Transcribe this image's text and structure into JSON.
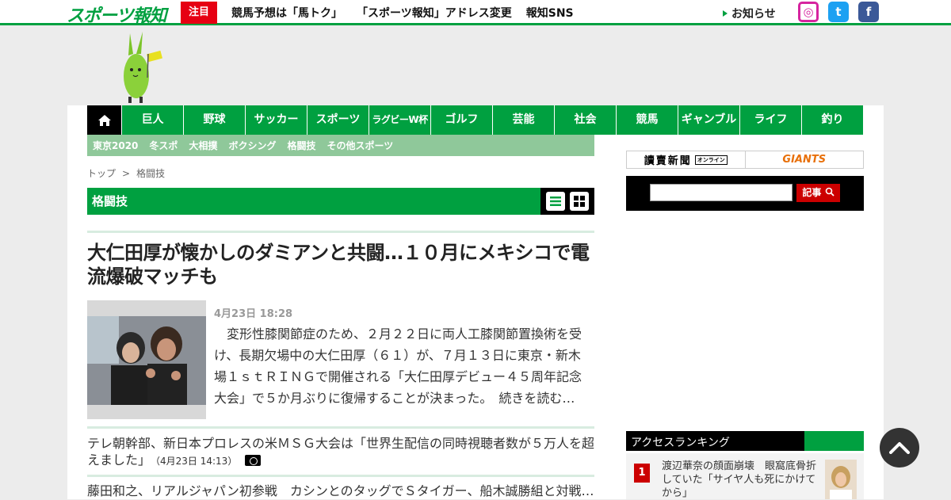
{
  "header": {
    "logo_text": "スポーツ報知",
    "badge": "注目",
    "links": [
      "競馬予想は「馬トク」",
      "「スポーツ報知」アドレス変更",
      "報知SNS"
    ],
    "notice": "お知らせ",
    "sns": [
      {
        "name": "instagram",
        "glyph": "◎"
      },
      {
        "name": "twitter",
        "glyph": "t"
      },
      {
        "name": "facebook",
        "glyph": "f"
      }
    ]
  },
  "nav": {
    "items": [
      "巨人",
      "野球",
      "サッカー",
      "スポーツ",
      "ラグビーW杯",
      "ゴルフ",
      "芸能",
      "社会",
      "競馬",
      "ギャンブル",
      "ライフ",
      "釣り"
    ],
    "sub_items": [
      "東京2020",
      "冬スポ",
      "大相撲",
      "ボクシング",
      "格闘技",
      "その他スポーツ"
    ]
  },
  "breadcrumb": {
    "home": "トップ",
    "separator": ">",
    "current": "格闘技"
  },
  "category": {
    "title": "格闘技"
  },
  "lead_article": {
    "title": "大仁田厚が懐かしのダミアンと共闘…１０月にメキシコで電流爆破マッチも",
    "date": "4月23日 18:28",
    "summary": "　変形性膝関節症のため、２月２２日に両人工膝関節置換術を受け、長期欠場中の大仁田厚（６１）が、７月１３日に東京・新木場１ｓｔＲＩＮＧで開催される「大仁田厚デビュー４５周年記念大会」で５か月ぶりに復帰することが決まった。",
    "read_more": "続きを読む…"
  },
  "articles": [
    {
      "title": "テレ朝幹部、新日本プロレスの米ＭＳＧ大会は「世界生配信の同時視聴者数が５万人を超えました」",
      "time": "（4月23日 14:13）",
      "has_photo": true
    },
    {
      "title": "藤田和之、リアルジャパン初参戦　カシンとのタッグでＳタイガー、船木誠勝組と対戦…",
      "time": "",
      "has_photo": false
    }
  ],
  "sidebar": {
    "banner_left": "讀賣新聞",
    "banner_left_tag": "オンライン",
    "banner_right": "GIANTS",
    "search_button": "記事",
    "ranking_title": "アクセスランキング",
    "ranking": [
      {
        "rank": "1",
        "title": "渡辺華奈の顔面崩壊　眼窩底骨折していた「サイヤ人も死にかけてから」"
      }
    ]
  },
  "colors": {
    "accent": "#00a040",
    "badge_red": "#e60012",
    "subnav": "#8fc89a"
  }
}
